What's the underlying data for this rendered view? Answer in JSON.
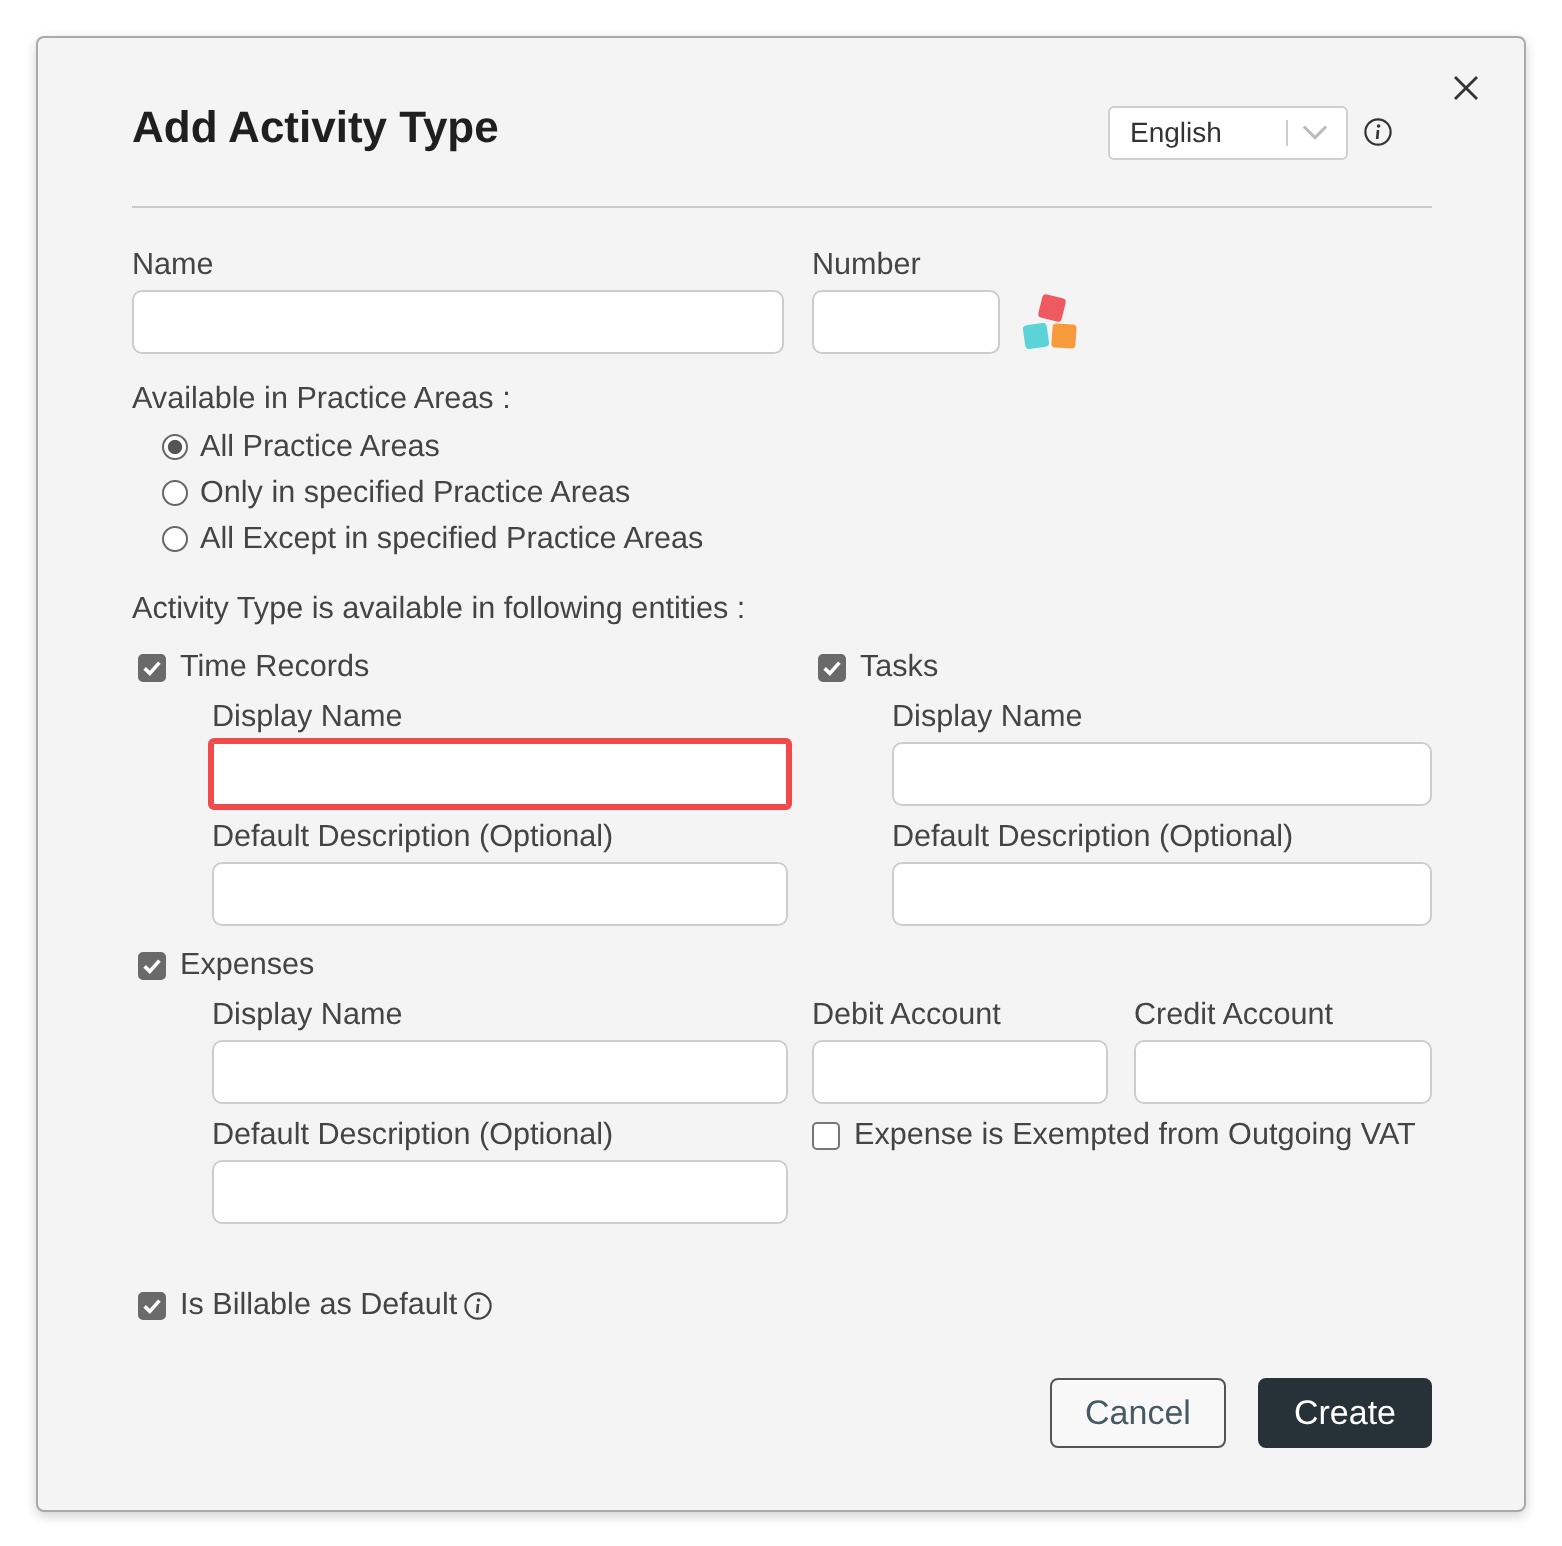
{
  "dialog": {
    "title": "Add Activity Type",
    "language": {
      "value": "English"
    }
  },
  "general": {
    "name": {
      "label": "Name",
      "invalid": false
    },
    "number": {
      "label": "Number",
      "invalid": false
    }
  },
  "practice_areas": {
    "label": "Available in Practice Areas :",
    "options": [
      {
        "label": "All Practice Areas",
        "selected": true
      },
      {
        "label": "Only in specified Practice Areas",
        "selected": false
      },
      {
        "label": "All Except in specified Practice Areas",
        "selected": false
      }
    ]
  },
  "entities": {
    "label": "Activity Type is available in following entities :",
    "time_records": {
      "label": "Time Records",
      "checked": true,
      "fields": [
        {
          "label": "Display Name",
          "invalid": true
        },
        {
          "label": "Default Description (Optional)",
          "invalid": false
        }
      ]
    },
    "tasks": {
      "label": "Tasks",
      "checked": true,
      "fields": [
        {
          "label": "Display Name",
          "invalid": false
        },
        {
          "label": "Default Description (Optional)",
          "invalid": false
        }
      ]
    },
    "expenses": {
      "label": "Expenses",
      "checked": true,
      "fields": [
        {
          "label": "Display Name",
          "invalid": false
        },
        {
          "label": "Default Description (Optional)",
          "invalid": false
        }
      ],
      "accounts": [
        {
          "label": "Debit Account",
          "invalid": false
        },
        {
          "label": "Credit Account",
          "invalid": false
        }
      ],
      "vat_exempt": {
        "label": "Expense is Exempted from Outgoing VAT",
        "checked": false
      }
    }
  },
  "billable": {
    "label": "Is Billable as Default",
    "checked": true
  },
  "buttons": [
    {
      "label": "Cancel",
      "kind": "secondary"
    },
    {
      "label": "Create",
      "kind": "primary"
    }
  ]
}
